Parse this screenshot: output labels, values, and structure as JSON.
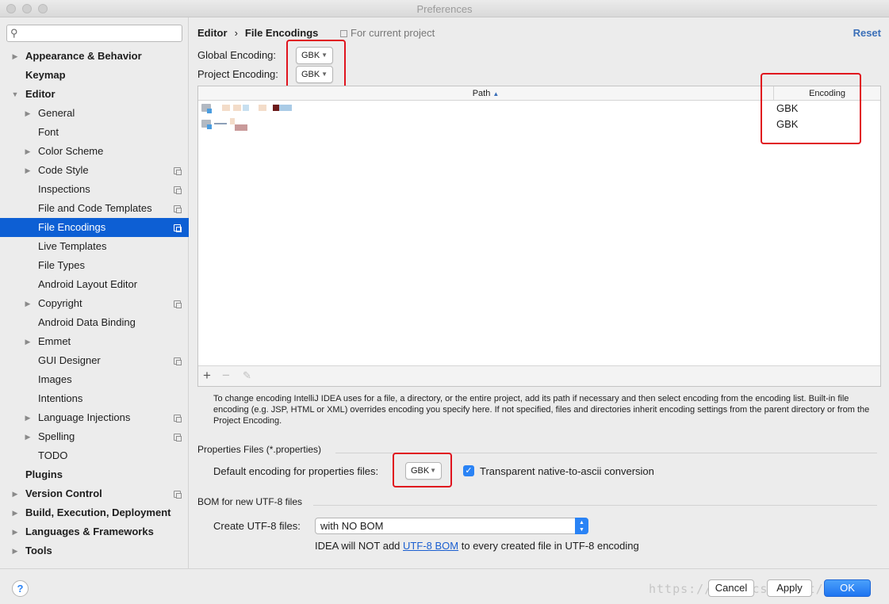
{
  "window": {
    "title": "Preferences"
  },
  "sidebar": {
    "search": {
      "value": "",
      "placeholder": ""
    },
    "items": [
      {
        "label": "Appearance & Behavior",
        "bold": true,
        "expandable": true,
        "expanded": false,
        "indent": 0,
        "copy_icon": false
      },
      {
        "label": "Keymap",
        "bold": true,
        "expandable": false,
        "indent": 0,
        "copy_icon": false
      },
      {
        "label": "Editor",
        "bold": true,
        "expandable": true,
        "expanded": true,
        "indent": 0,
        "copy_icon": false
      },
      {
        "label": "General",
        "bold": false,
        "expandable": true,
        "expanded": false,
        "indent": 1,
        "copy_icon": false
      },
      {
        "label": "Font",
        "bold": false,
        "expandable": false,
        "indent": 1,
        "copy_icon": false
      },
      {
        "label": "Color Scheme",
        "bold": false,
        "expandable": true,
        "expanded": false,
        "indent": 1,
        "copy_icon": false
      },
      {
        "label": "Code Style",
        "bold": false,
        "expandable": true,
        "expanded": false,
        "indent": 1,
        "copy_icon": true
      },
      {
        "label": "Inspections",
        "bold": false,
        "expandable": false,
        "indent": 1,
        "copy_icon": true
      },
      {
        "label": "File and Code Templates",
        "bold": false,
        "expandable": false,
        "indent": 1,
        "copy_icon": true
      },
      {
        "label": "File Encodings",
        "bold": false,
        "expandable": false,
        "indent": 1,
        "copy_icon": true,
        "selected": true
      },
      {
        "label": "Live Templates",
        "bold": false,
        "expandable": false,
        "indent": 1,
        "copy_icon": false
      },
      {
        "label": "File Types",
        "bold": false,
        "expandable": false,
        "indent": 1,
        "copy_icon": false
      },
      {
        "label": "Android Layout Editor",
        "bold": false,
        "expandable": false,
        "indent": 1,
        "copy_icon": false
      },
      {
        "label": "Copyright",
        "bold": false,
        "expandable": true,
        "expanded": false,
        "indent": 1,
        "copy_icon": true
      },
      {
        "label": "Android Data Binding",
        "bold": false,
        "expandable": false,
        "indent": 1,
        "copy_icon": false
      },
      {
        "label": "Emmet",
        "bold": false,
        "expandable": true,
        "expanded": false,
        "indent": 1,
        "copy_icon": false
      },
      {
        "label": "GUI Designer",
        "bold": false,
        "expandable": false,
        "indent": 1,
        "copy_icon": true
      },
      {
        "label": "Images",
        "bold": false,
        "expandable": false,
        "indent": 1,
        "copy_icon": false
      },
      {
        "label": "Intentions",
        "bold": false,
        "expandable": false,
        "indent": 1,
        "copy_icon": false
      },
      {
        "label": "Language Injections",
        "bold": false,
        "expandable": true,
        "expanded": false,
        "indent": 1,
        "copy_icon": true
      },
      {
        "label": "Spelling",
        "bold": false,
        "expandable": true,
        "expanded": false,
        "indent": 1,
        "copy_icon": true
      },
      {
        "label": "TODO",
        "bold": false,
        "expandable": false,
        "indent": 1,
        "copy_icon": false
      },
      {
        "label": "Plugins",
        "bold": true,
        "expandable": false,
        "indent": 0,
        "copy_icon": false
      },
      {
        "label": "Version Control",
        "bold": true,
        "expandable": true,
        "expanded": false,
        "indent": 0,
        "copy_icon": true
      },
      {
        "label": "Build, Execution, Deployment",
        "bold": true,
        "expandable": true,
        "expanded": false,
        "indent": 0,
        "copy_icon": false
      },
      {
        "label": "Languages & Frameworks",
        "bold": true,
        "expandable": true,
        "expanded": false,
        "indent": 0,
        "copy_icon": false
      },
      {
        "label": "Tools",
        "bold": true,
        "expandable": true,
        "expanded": false,
        "indent": 0,
        "copy_icon": false
      }
    ]
  },
  "header": {
    "crumb_parent": "Editor",
    "crumb_sep": "›",
    "crumb_current": "File Encodings",
    "scope": "For current project",
    "reset": "Reset"
  },
  "encodings": {
    "global_label": "Global Encoding:",
    "global_value": "GBK",
    "project_label": "Project Encoding:",
    "project_value": "GBK"
  },
  "table": {
    "col_path": "Path",
    "col_encoding": "Encoding",
    "rows": [
      {
        "encoding": "GBK"
      },
      {
        "encoding": "GBK"
      }
    ],
    "toolbar": {
      "add": "+",
      "remove": "−",
      "edit": "✎"
    }
  },
  "hint": "To change encoding IntelliJ IDEA uses for a file, a directory, or the entire project, add its path if necessary and then select encoding from the encoding list. Built-in file encoding (e.g. JSP, HTML or XML) overrides encoding you specify here. If not specified, files and directories inherit encoding settings from the parent directory or from the Project Encoding.",
  "properties": {
    "group_title": "Properties Files (*.properties)",
    "default_label": "Default encoding for properties files:",
    "default_value": "GBK",
    "transparent_checked": true,
    "transparent_label": "Transparent native-to-ascii conversion"
  },
  "bom": {
    "group_title": "BOM for new UTF-8 files",
    "create_label": "Create UTF-8 files:",
    "create_value": "with NO BOM",
    "note_prefix": "IDEA will NOT add",
    "note_link": "UTF-8 BOM",
    "note_suffix": "to every created file in UTF-8 encoding"
  },
  "footer": {
    "help": "?",
    "cancel": "Cancel",
    "apply": "Apply",
    "ok": "OK",
    "watermark": "https://blog.csdn.net/becxx"
  },
  "colors": {
    "selection": "#0d5fd4",
    "annotation_red": "#e0141e",
    "accent_blue": "#2a83f5",
    "link": "#1b5fd0"
  }
}
